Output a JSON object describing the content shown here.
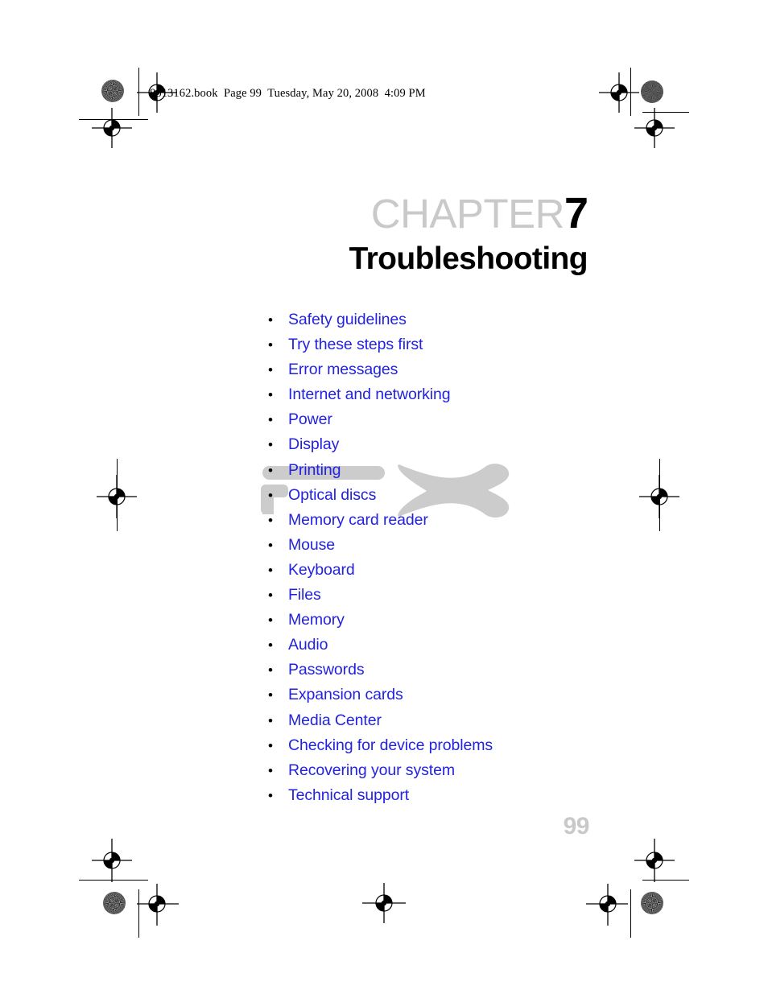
{
  "page": {
    "slug": "8513162.book  Page 99  Tuesday, May 20, 2008  4:09 PM",
    "folio": "99",
    "background_color": "#ffffff"
  },
  "heading": {
    "chapter_word": "CHAPTER",
    "chapter_number": "7",
    "title": "Troubleshooting",
    "chapter_word_color": "#c9c9c9",
    "chapter_number_color": "#000000",
    "title_color": "#000000"
  },
  "toc": {
    "bullet_glyph": "•",
    "link_color": "#2222e0",
    "items": [
      {
        "label": "Safety guidelines"
      },
      {
        "label": "Try these steps first"
      },
      {
        "label": "Error messages"
      },
      {
        "label": "Internet and networking"
      },
      {
        "label": "Power"
      },
      {
        "label": "Display"
      },
      {
        "label": "Printing"
      },
      {
        "label": "Optical discs"
      },
      {
        "label": "Memory card reader"
      },
      {
        "label": "Mouse"
      },
      {
        "label": "Keyboard"
      },
      {
        "label": "Files"
      },
      {
        "label": "Memory"
      },
      {
        "label": "Audio"
      },
      {
        "label": "Passwords"
      },
      {
        "label": "Expansion cards"
      },
      {
        "label": "Media Center"
      },
      {
        "label": "Checking for device problems"
      },
      {
        "label": "Recovering your system"
      },
      {
        "label": "Technical support"
      }
    ]
  },
  "decoration": {
    "watermark_name": "bowtie-bracket-watermark",
    "watermark_color": "#cccccc"
  },
  "printers_marks": {
    "registration_mark_name": "registration-target-icon",
    "density_patch_name": "density-patch-icon",
    "mark_color": "#000000"
  }
}
